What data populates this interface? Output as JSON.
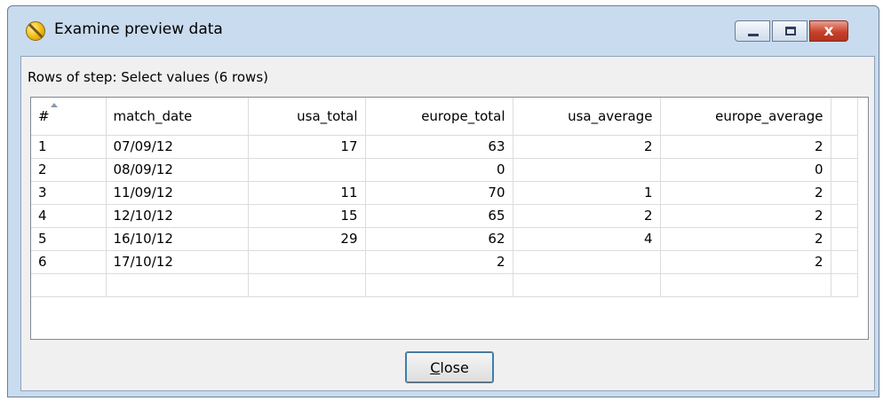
{
  "window": {
    "title": "Examine preview data",
    "icon": "spoon-icon"
  },
  "caption_buttons": {
    "minimize": "minimize-icon",
    "maximize": "maximize-icon",
    "close_glyph": "x"
  },
  "rows_label": "Rows of step: Select values (6 rows)",
  "table": {
    "columns": [
      "#",
      "match_date",
      "usa_total",
      "europe_total",
      "usa_average",
      "europe_average"
    ],
    "rows": [
      [
        "1",
        "07/09/12",
        "17",
        "63",
        "2",
        "2"
      ],
      [
        "2",
        "08/09/12",
        "",
        "0",
        "",
        "0"
      ],
      [
        "3",
        "11/09/12",
        "11",
        "70",
        "1",
        "2"
      ],
      [
        "4",
        "12/10/12",
        "15",
        "65",
        "2",
        "2"
      ],
      [
        "5",
        "16/10/12",
        "29",
        "62",
        "4",
        "2"
      ],
      [
        "6",
        "17/10/12",
        "",
        "2",
        "",
        "2"
      ]
    ]
  },
  "buttons": {
    "close_mnemonic": "C",
    "close_rest": "lose"
  },
  "colors": {
    "title_bar": "#c9dbee",
    "close_button": "#c7412b"
  }
}
